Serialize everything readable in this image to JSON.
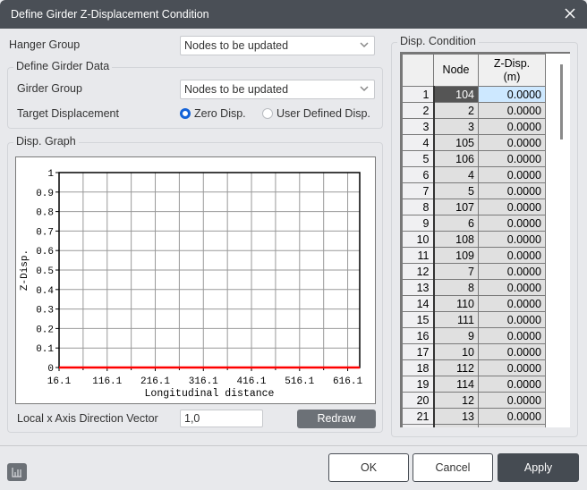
{
  "window": {
    "title": "Define Girder Z-Displacement Condition",
    "close_icon": "close-icon"
  },
  "hanger_group": {
    "label": "Hanger Group",
    "value": "Nodes to be updated"
  },
  "girder_data": {
    "legend": "Define Girder Data",
    "girder_group_label": "Girder Group",
    "girder_group_value": "Nodes to be updated",
    "target_label": "Target Displacement",
    "radio_zero": "Zero Disp.",
    "radio_user": "User Defined Disp.",
    "selected": "zero"
  },
  "graph": {
    "legend": "Disp. Graph",
    "vector_label": "Local x Axis Direction Vector",
    "vector_value": "1,0",
    "redraw_label": "Redraw"
  },
  "chart_data": {
    "type": "line",
    "title": "",
    "xlabel": "Longitudinal distance",
    "ylabel": "Z-Disp.",
    "x_ticks": [
      "16.1",
      "116.1",
      "216.1",
      "316.1",
      "416.1",
      "516.1",
      "616.1"
    ],
    "y_ticks": [
      "0",
      "0.1",
      "0.2",
      "0.3",
      "0.4",
      "0.5",
      "0.6",
      "0.7",
      "0.8",
      "0.9",
      "1"
    ],
    "xlim": [
      16.1,
      641.1
    ],
    "ylim": [
      0,
      1
    ],
    "grid": true,
    "series": [
      {
        "name": "Z-Disp.",
        "color": "#ff0000",
        "x": [
          16.1,
          641.1
        ],
        "y": [
          0,
          0
        ]
      }
    ]
  },
  "disp_condition": {
    "legend": "Disp. Condition",
    "columns": [
      "Node",
      "Z-Disp.\n(m)"
    ],
    "column_node": "Node",
    "column_zdisp_1": "Z-Disp.",
    "column_zdisp_2": "(m)",
    "selected_row": 1,
    "rows": [
      {
        "n": "1",
        "node": "104",
        "z": "0.0000"
      },
      {
        "n": "2",
        "node": "2",
        "z": "0.0000"
      },
      {
        "n": "3",
        "node": "3",
        "z": "0.0000"
      },
      {
        "n": "4",
        "node": "105",
        "z": "0.0000"
      },
      {
        "n": "5",
        "node": "106",
        "z": "0.0000"
      },
      {
        "n": "6",
        "node": "4",
        "z": "0.0000"
      },
      {
        "n": "7",
        "node": "5",
        "z": "0.0000"
      },
      {
        "n": "8",
        "node": "107",
        "z": "0.0000"
      },
      {
        "n": "9",
        "node": "6",
        "z": "0.0000"
      },
      {
        "n": "10",
        "node": "108",
        "z": "0.0000"
      },
      {
        "n": "11",
        "node": "109",
        "z": "0.0000"
      },
      {
        "n": "12",
        "node": "7",
        "z": "0.0000"
      },
      {
        "n": "13",
        "node": "8",
        "z": "0.0000"
      },
      {
        "n": "14",
        "node": "110",
        "z": "0.0000"
      },
      {
        "n": "15",
        "node": "111",
        "z": "0.0000"
      },
      {
        "n": "16",
        "node": "9",
        "z": "0.0000"
      },
      {
        "n": "17",
        "node": "10",
        "z": "0.0000"
      },
      {
        "n": "18",
        "node": "112",
        "z": "0.0000"
      },
      {
        "n": "19",
        "node": "114",
        "z": "0.0000"
      },
      {
        "n": "20",
        "node": "12",
        "z": "0.0000"
      },
      {
        "n": "21",
        "node": "13",
        "z": "0.0000"
      }
    ]
  },
  "footer": {
    "ok_label": "OK",
    "cancel_label": "Cancel",
    "apply_label": "Apply",
    "chart_icon": "bar-chart-icon"
  },
  "colors": {
    "titlebar": "#4a4f56",
    "accent": "#1463d8",
    "selection": "#cde8ff",
    "series": "#ff0000"
  }
}
